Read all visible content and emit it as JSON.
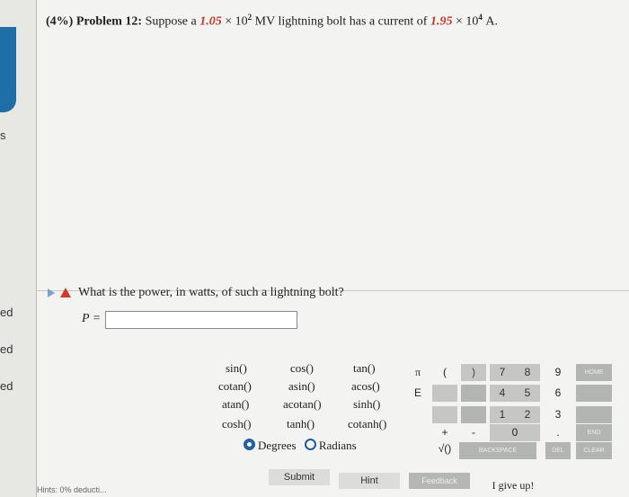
{
  "sidebar": {
    "labels": [
      "s",
      "ed",
      "ed",
      "ed"
    ]
  },
  "problem": {
    "header": "(4%) Problem 12:",
    "text_1": "Suppose a",
    "energy_value": "1.05",
    "times": "×",
    "energy_base": "10",
    "energy_exp": "2",
    "energy_unit": "MV lightning bolt has a current of",
    "current_value": "1.95",
    "current_base": "10",
    "current_exp": "4",
    "current_unit": "A."
  },
  "question": {
    "text": "What is the power, in watts, of such a lightning bolt?",
    "answer_label": "P =",
    "answer_value": ""
  },
  "functions": [
    [
      "sin()",
      "cos()",
      "tan()"
    ],
    [
      "cotan()",
      "asin()",
      "acos()"
    ],
    [
      "atan()",
      "acotan()",
      "sinh()"
    ],
    [
      "cosh()",
      "tanh()",
      "cotanh()"
    ]
  ],
  "angle_mode": {
    "degrees": "Degrees",
    "radians": "Radians",
    "selected": "Degrees"
  },
  "keypad": {
    "pi": "π",
    "e": "E",
    "open_paren": "(",
    "close_paren": ")",
    "plus": "+",
    "minus": "-",
    "sqrt": "√()",
    "digits_row1": [
      "7",
      "8",
      "9"
    ],
    "digits_row2": [
      "4",
      "5",
      "6"
    ],
    "digits_row3": [
      "1",
      "2",
      "3"
    ],
    "zero": "0",
    "dot": ".",
    "home": "HOME",
    "end": "END",
    "clear": "CLEAR",
    "backspace": "BACKSPACE",
    "del": "DEL"
  },
  "actions": {
    "submit": "Submit",
    "hint": "Hint",
    "feedback": "Feedback",
    "give_up": "I give up!"
  },
  "hints_text": "Hints: 0% deducti..."
}
